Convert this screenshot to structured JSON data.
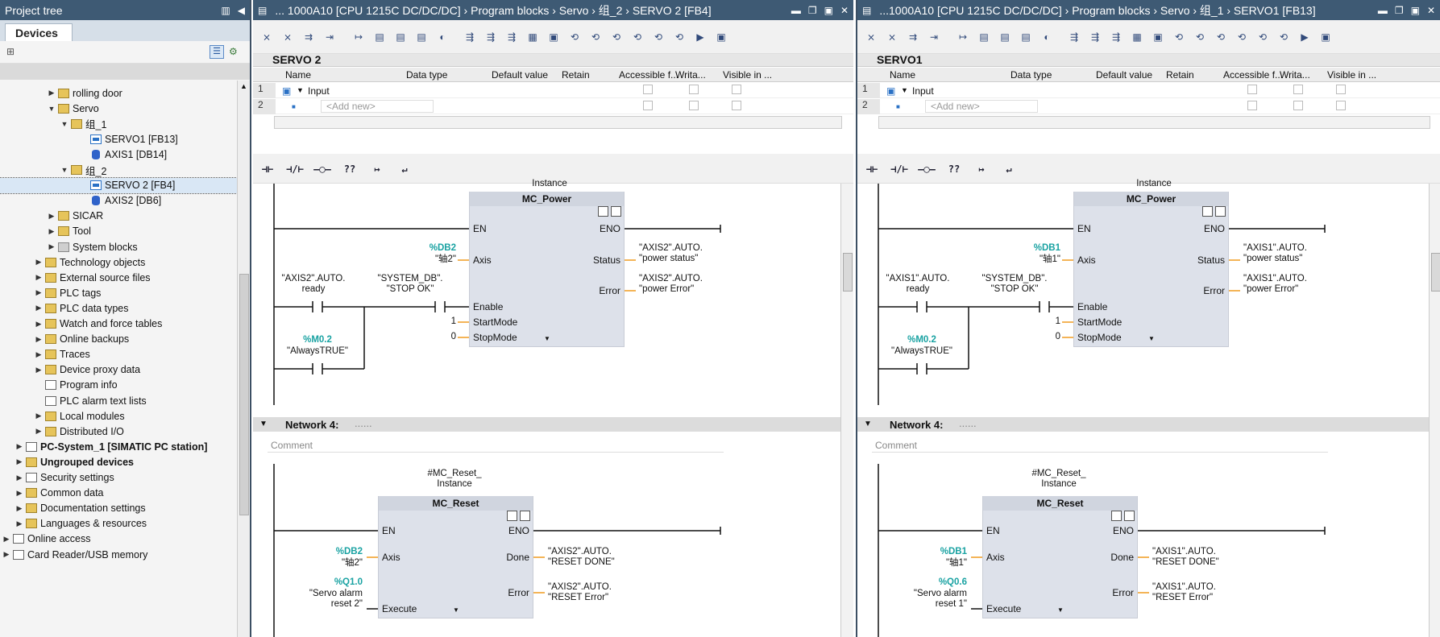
{
  "tree": {
    "title": "Project tree",
    "tab": "Devices",
    "items": [
      {
        "label": "rolling door",
        "icon": "folder-icon"
      },
      {
        "label": "Servo",
        "icon": "folder-icon"
      },
      {
        "label": "组_1",
        "icon": "folder-icon"
      },
      {
        "label": "SERVO1 [FB13]",
        "icon": "fb-icon"
      },
      {
        "label": "AXIS1 [DB14]",
        "icon": "db-icon"
      },
      {
        "label": "组_2",
        "icon": "folder-icon"
      },
      {
        "label": "SERVO 2 [FB4]",
        "icon": "fb-icon"
      },
      {
        "label": "AXIS2 [DB6]",
        "icon": "db-icon"
      },
      {
        "label": "SICAR",
        "icon": "folder-icon"
      },
      {
        "label": "Tool",
        "icon": "folder-icon"
      },
      {
        "label": "System blocks",
        "icon": "folder-icon"
      },
      {
        "label": "Technology objects",
        "icon": "folder-icon"
      },
      {
        "label": "External source files",
        "icon": "folder-icon"
      },
      {
        "label": "PLC tags",
        "icon": "folder-icon"
      },
      {
        "label": "PLC data types",
        "icon": "folder-icon"
      },
      {
        "label": "Watch and force tables",
        "icon": "folder-icon"
      },
      {
        "label": "Online backups",
        "icon": "folder-icon"
      },
      {
        "label": "Traces",
        "icon": "folder-icon"
      },
      {
        "label": "Device proxy data",
        "icon": "folder-icon"
      },
      {
        "label": "Program info",
        "icon": "info-icon"
      },
      {
        "label": "PLC alarm text lists",
        "icon": "list-icon"
      },
      {
        "label": "Local modules",
        "icon": "folder-icon"
      },
      {
        "label": "Distributed I/O",
        "icon": "folder-icon"
      },
      {
        "label": "PC-System_1 [SIMATIC PC station]",
        "icon": "pc-icon"
      },
      {
        "label": "Ungrouped devices",
        "icon": "folder-icon"
      },
      {
        "label": "Security settings",
        "icon": "security-icon"
      },
      {
        "label": "Common data",
        "icon": "folder-icon"
      },
      {
        "label": "Documentation settings",
        "icon": "folder-icon"
      },
      {
        "label": "Languages & resources",
        "icon": "folder-icon"
      },
      {
        "label": "Online access",
        "icon": "online-icon"
      },
      {
        "label": "Card Reader/USB memory",
        "icon": "card-icon"
      }
    ]
  },
  "columns": [
    "Name",
    "Data type",
    "Default value",
    "Retain",
    "Accessible f...",
    "Writa...",
    "Visible in ..."
  ],
  "iface": {
    "row1": "Input",
    "row2": "<Add new>"
  },
  "ladder_buttons": [
    "⊣⊢",
    "⊣/⊢",
    "–◯–",
    "??",
    "↦",
    "↵"
  ],
  "common": {
    "instance": "Instance",
    "mc_power": "MC_Power",
    "mc_reset": "MC_Reset",
    "reset_instance": "#MC_Reset_\nInstance",
    "network4": "Network 4:",
    "net_dots": "......",
    "comment": "Comment",
    "en": "EN",
    "eno": "ENO",
    "axis": "Axis",
    "status": "Status",
    "error": "Error",
    "enable": "Enable",
    "startmode": "StartMode",
    "stopmode": "StopMode",
    "done": "Done",
    "execute": "Execute",
    "startmode_val": "1",
    "stopmode_val": "0",
    "sys_db": "\"SYSTEM_DB\".\n\"STOP OK\"",
    "m02": "%M0.2",
    "alwaystrue": "\"AlwaysTRUE\""
  },
  "editor_left": {
    "title": "... 1000A10 [CPU 1215C DC/DC/DC]  ›  Program blocks  ›  Servo  ›  组_2  ›  SERVO 2 [FB4]",
    "block": "SERVO 2",
    "db": "%DB2",
    "axis_name": "\"轴2\"",
    "power_status": "\"AXIS2\".AUTO.\n\"power status\"",
    "power_error": "\"AXIS2\".AUTO.\n\"power Error\"",
    "ready": "\"AXIS2\".AUTO.\nready",
    "reset_done": "\"AXIS2\".AUTO.\n\"RESET DONE\"",
    "reset_error": "\"AXIS2\".AUTO.\n\"RESET Error\"",
    "q": "%Q1.0",
    "q_name": "\"Servo alarm\nreset 2\""
  },
  "editor_right": {
    "title": "...1000A10 [CPU 1215C DC/DC/DC]  ›  Program blocks  ›  Servo  ›  组_1  ›  SERVO1 [FB13]",
    "block": "SERVO1",
    "db": "%DB1",
    "axis_name": "\"轴1\"",
    "power_status": "\"AXIS1\".AUTO.\n\"power status\"",
    "power_error": "\"AXIS1\".AUTO.\n\"power Error\"",
    "ready": "\"AXIS1\".AUTO.\nready",
    "reset_done": "\"AXIS1\".AUTO.\n\"RESET DONE\"",
    "reset_error": "\"AXIS1\".AUTO.\n\"RESET Error\"",
    "q": "%Q0.6",
    "q_name": "\"Servo alarm\nreset 1\""
  }
}
